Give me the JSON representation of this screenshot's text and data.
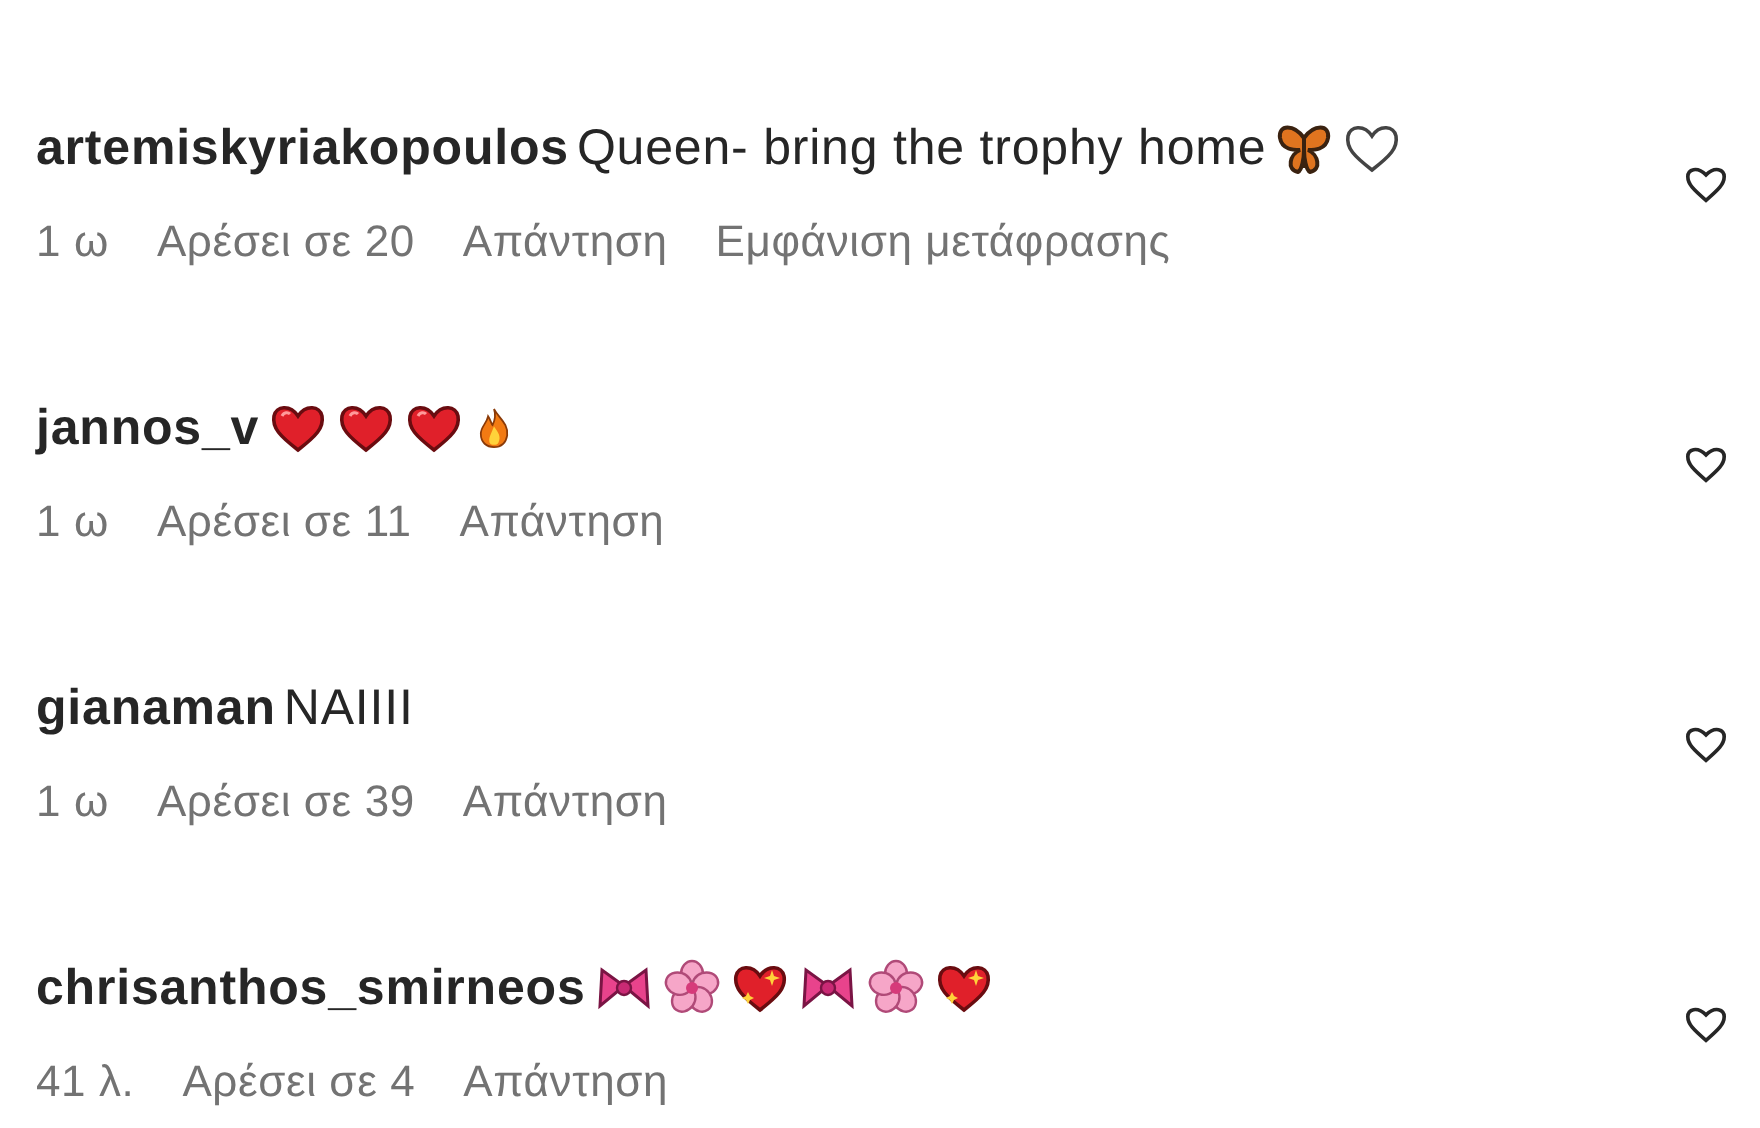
{
  "comments": [
    {
      "username": "artemiskyriakopoulos",
      "text": "Queen- bring the trophy home",
      "emojis": [
        {
          "kind": "butterfly"
        },
        {
          "kind": "white-heart"
        }
      ],
      "meta": [
        "1 ω",
        "Αρέσει σε 20",
        "Απάντηση",
        "Εμφάνιση μετάφρασης"
      ]
    },
    {
      "username": "jannos_v",
      "emojis": [
        {
          "kind": "red-heart"
        },
        {
          "kind": "red-heart"
        },
        {
          "kind": "red-heart"
        },
        {
          "kind": "fire"
        }
      ],
      "meta": [
        "1 ω",
        "Αρέσει σε 11",
        "Απάντηση"
      ]
    },
    {
      "username": "gianaman",
      "text": "NAIIII",
      "meta": [
        "1 ω",
        "Αρέσει σε 39",
        "Απάντηση"
      ]
    },
    {
      "username": "chrisanthos_smirneos",
      "emojis": [
        {
          "kind": "ribbon"
        },
        {
          "kind": "blossom"
        },
        {
          "kind": "sparkling-heart"
        },
        {
          "kind": "ribbon"
        },
        {
          "kind": "blossom"
        },
        {
          "kind": "sparkling-heart"
        }
      ],
      "meta": [
        "41 λ.",
        "Αρέσει σε 4",
        "Απάντηση"
      ]
    }
  ]
}
